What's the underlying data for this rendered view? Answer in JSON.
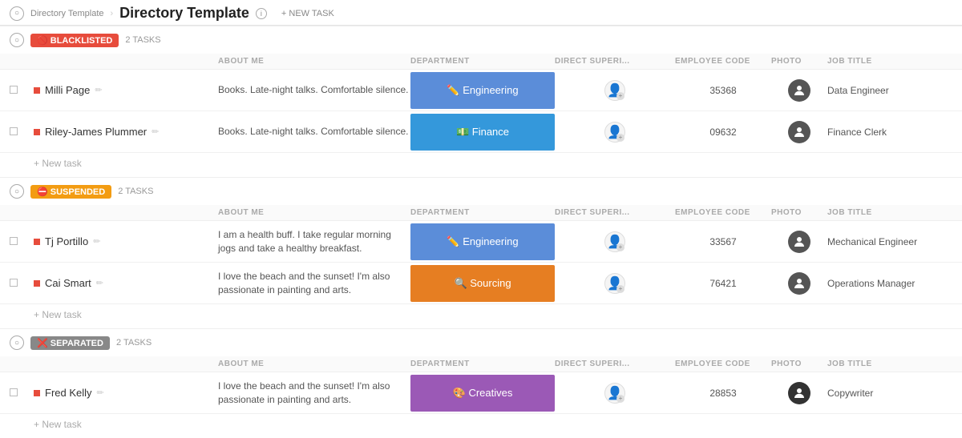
{
  "header": {
    "breadcrumb": "Directory Template",
    "title": "Directory Template",
    "new_task_btn": "+ NEW TASK"
  },
  "sections": [
    {
      "id": "blacklisted",
      "badge_text": "🚫 BLACKLISTED",
      "badge_class": "badge-blacklisted",
      "badge_emoji": "🚫",
      "badge_label": "BLACKLISTED",
      "tasks_text": "2 TASKS",
      "columns": [
        "",
        "ABOUT ME",
        "DEPARTMENT",
        "DIRECT SUPERI...",
        "EMPLOYEE CODE",
        "PHOTO",
        "JOB TITLE"
      ],
      "rows": [
        {
          "name": "Milli Page",
          "about": "Books. Late-night talks. Comfortable silence.",
          "dept": "Engineering",
          "dept_class": "dept-engineering",
          "dept_icon": "✏️",
          "emp_code": "35368",
          "job_title": "Data Engineer"
        },
        {
          "name": "Riley-James Plummer",
          "about": "Books. Late-night talks. Comfortable silence.",
          "dept": "Finance",
          "dept_class": "dept-finance",
          "dept_icon": "💵",
          "emp_code": "09632",
          "job_title": "Finance Clerk"
        }
      ],
      "new_task_label": "+ New task"
    },
    {
      "id": "suspended",
      "badge_text": "⛔ SUSPENDED",
      "badge_class": "badge-suspended",
      "badge_emoji": "⛔",
      "badge_label": "SUSPENDED",
      "tasks_text": "2 TASKS",
      "columns": [
        "",
        "ABOUT ME",
        "DEPARTMENT",
        "DIRECT SUPERI...",
        "EMPLOYEE CODE",
        "PHOTO",
        "JOB TITLE"
      ],
      "rows": [
        {
          "name": "Tj Portillo",
          "about": "I am a health buff. I take regular morning jogs and take a healthy breakfast.",
          "dept": "Engineering",
          "dept_class": "dept-engineering",
          "dept_icon": "✏️",
          "emp_code": "33567",
          "job_title": "Mechanical Engineer"
        },
        {
          "name": "Cai Smart",
          "about": "I love the beach and the sunset! I'm also passionate in painting and arts.",
          "dept": "Sourcing",
          "dept_class": "dept-sourcing",
          "dept_icon": "🔍",
          "emp_code": "76421",
          "job_title": "Operations Manager"
        }
      ],
      "new_task_label": "+ New task"
    },
    {
      "id": "separated",
      "badge_text": "❌ SEPARATED",
      "badge_class": "badge-separated",
      "badge_emoji": "❌",
      "badge_label": "SEPARATED",
      "tasks_text": "2 TASKS",
      "columns": [
        "",
        "ABOUT ME",
        "DEPARTMENT",
        "DIRECT SUPERI...",
        "EMPLOYEE CODE",
        "PHOTO",
        "JOB TITLE"
      ],
      "rows": [
        {
          "name": "Fred Kelly",
          "about": "I love the beach and the sunset! I'm also passionate in painting and arts.",
          "dept": "Creatives",
          "dept_class": "dept-creatives",
          "dept_icon": "🎨",
          "emp_code": "28853",
          "job_title": "Copywriter"
        }
      ],
      "new_task_label": "+ New task"
    }
  ]
}
